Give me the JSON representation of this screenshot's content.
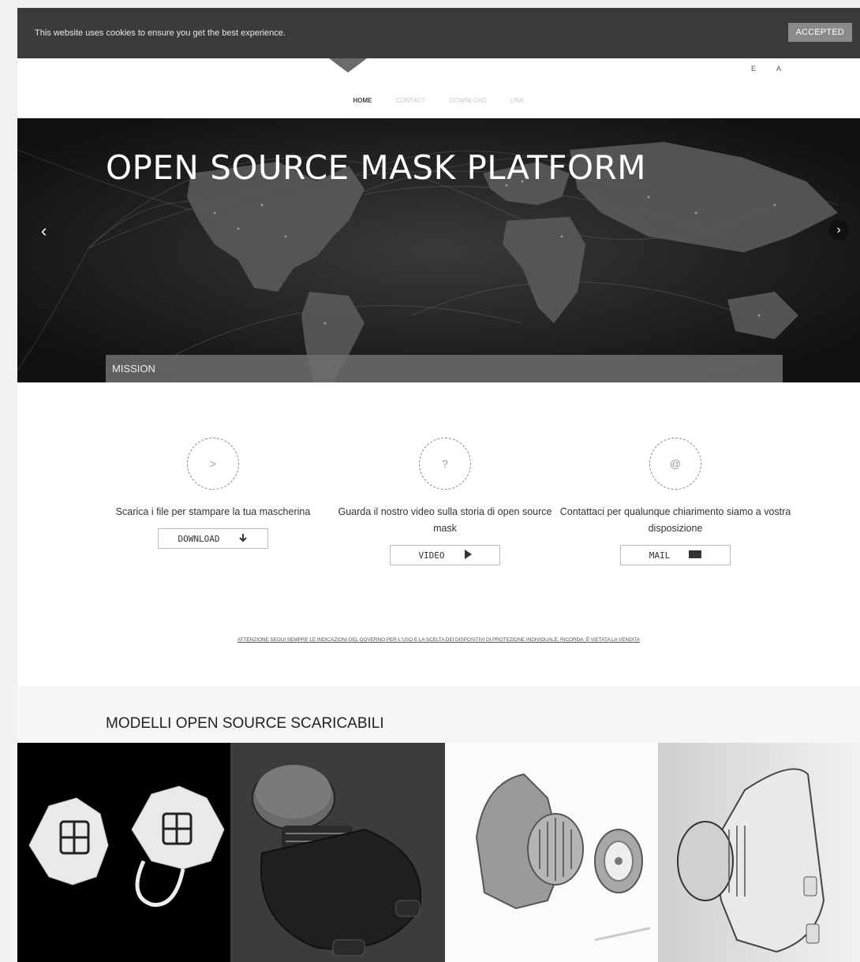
{
  "cookie_bar": {
    "message": "This website uses cookies to ensure you get the best experience.",
    "accept_label": "ACCEPTED"
  },
  "header": {
    "lang": "E A"
  },
  "nav": {
    "items": [
      "HOME",
      "CONTACT",
      "DOWNLOAD",
      "LINK"
    ],
    "active": "HOME"
  },
  "hero": {
    "title": "OPEN SOURCE MASK PLATFORM",
    "caption": "MISSION",
    "prev_icon": "chevron-left",
    "next_icon": "chevron-right-circle"
  },
  "features": [
    {
      "icon_glyph": ">",
      "text": "Scarica i file per stampare la tua mascherina",
      "button_label": "DOWNLOAD",
      "button_icon": "download-arrow"
    },
    {
      "icon_glyph": "?",
      "text": "Guarda il nostro video sulla storia di open source mask",
      "button_label": "VIDEO",
      "button_icon": "play-triangle"
    },
    {
      "icon_glyph": "@",
      "text": "Contattaci per qualunque chiarimento siamo a vostra disposizione",
      "button_label": "MAIL",
      "button_icon": "mail-envelope"
    }
  ],
  "notice": "ATTENZIONE SEGUI SEMPRE LE INDICAZIONI DEL GOVERNO PER L'USO E LA SCELTA DEI DISPOSITIVI DI PROTEZIONE INDIVIDUALE. RICORDA: È VIETATA LA VENDITA",
  "models": {
    "title": "MODELLI OPEN SOURCE SCARICABILI"
  },
  "colors": {
    "cookie_bg": "#3b3b3b",
    "hero_bg": "#1a1a1a",
    "mission_bar": "#6e6e6e"
  }
}
